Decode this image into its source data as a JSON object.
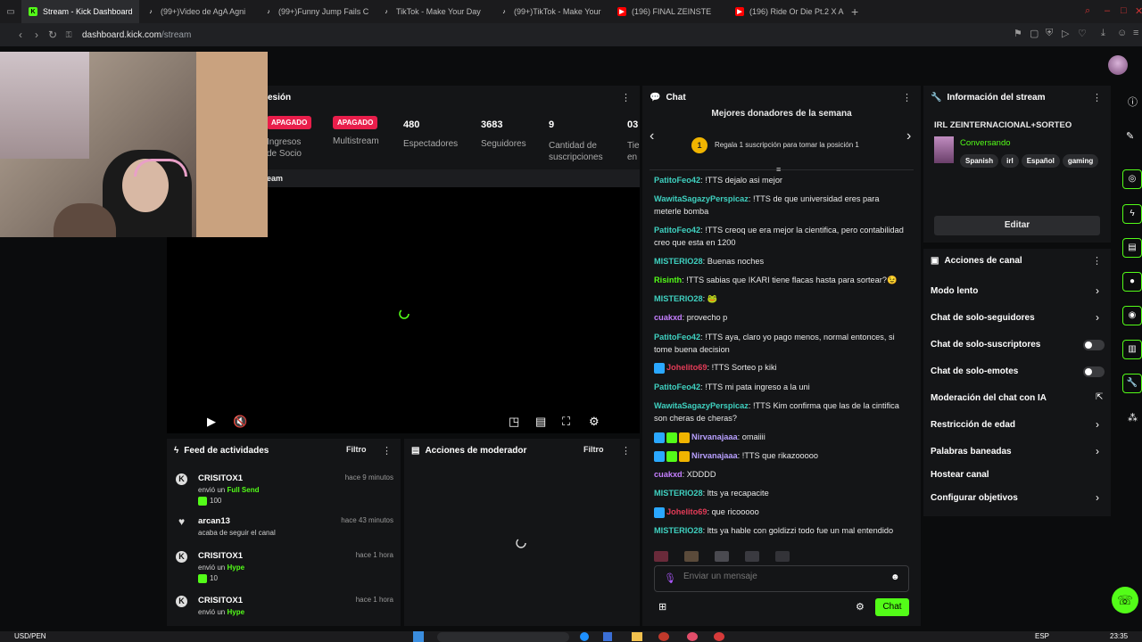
{
  "browser": {
    "tabs": [
      {
        "title": "Stream - Kick Dashboard",
        "active": true,
        "icon": "kick-icon"
      },
      {
        "title": "(99+)Video de AgA Agni",
        "active": false,
        "icon": "tiktok-icon"
      },
      {
        "title": "(99+)Funny Jump Fails C",
        "active": false,
        "icon": "tiktok-icon"
      },
      {
        "title": "TikTok - Make Your Day",
        "active": false,
        "icon": "tiktok-icon"
      },
      {
        "title": "(99+)TikTok - Make Your",
        "active": false,
        "icon": "tiktok-icon"
      },
      {
        "title": "(196) FINAL ZEINSTE",
        "active": false,
        "icon": "youtube-icon"
      },
      {
        "title": "(196) Ride Or Die Pt.2 X A",
        "active": false,
        "icon": "youtube-icon"
      }
    ],
    "url_host": "dashboard.kick.com",
    "url_path": "/stream"
  },
  "session": {
    "title": "esión",
    "stats": [
      {
        "badge": "APAGADO",
        "label": "Ingresos de Socio"
      },
      {
        "badge": "APAGADO",
        "label": "Multistream"
      },
      {
        "value": "480",
        "label": "Espectadores"
      },
      {
        "value": "3683",
        "label": "Seguidores"
      },
      {
        "value": "9",
        "label": "Cantidad de suscripciones"
      },
      {
        "value": "03",
        "label": "Tie en"
      }
    ],
    "stream_label": "eam"
  },
  "feed": {
    "title": "Feed de actividades",
    "filter": "Filtro",
    "items": [
      {
        "user": "CRISITOX1",
        "action": "envió un",
        "highlight": "Full Send",
        "amount": "100",
        "time": "hace 9 minutos",
        "icon": "kick-coin-icon"
      },
      {
        "user": "arcan13",
        "action": "acaba de seguir el canal",
        "highlight": "",
        "amount": "",
        "time": "hace 43 minutos",
        "icon": "heart-icon"
      },
      {
        "user": "CRISITOX1",
        "action": "envió un",
        "highlight": "Hype",
        "amount": "10",
        "time": "hace 1 hora",
        "icon": "kick-coin-icon"
      },
      {
        "user": "CRISITOX1",
        "action": "envió un",
        "highlight": "Hype",
        "amount": "",
        "time": "hace 1 hora",
        "icon": "kick-coin-icon"
      }
    ]
  },
  "moderator": {
    "title": "Acciones de moderador",
    "filter": "Filtro"
  },
  "chat": {
    "title": "Chat",
    "donors_title": "Mejores donadores de la semana",
    "donors_rank": "1",
    "donors_text": "Regala 1 suscripción para tomar la posición 1",
    "messages": [
      {
        "user": "PatitoFeo42",
        "cls": "u-g",
        "text": "!TTS dejalo asi mejor"
      },
      {
        "user": "WawitaSagazyPerspicaz",
        "cls": "u-g",
        "text": "!TTS de que universidad eres para meterle bomba"
      },
      {
        "user": "PatitoFeo42",
        "cls": "u-g",
        "text": "!TTS creoq ue era mejor la cientifica, pero contabilidad creo que esta en 1200"
      },
      {
        "user": "MISTERIO28",
        "cls": "u-g",
        "text": "Buenas noches"
      },
      {
        "user": "Risinth",
        "cls": "u-g",
        "text": "!TTS sabias que IKARI tiene flacas hasta para sortear?😉"
      },
      {
        "user": "MISTERIO28",
        "cls": "u-g",
        "text": "🐸"
      },
      {
        "user": "cuakxd",
        "cls": "u-p",
        "text": "provecho p"
      },
      {
        "user": "PatitoFeo42",
        "cls": "u-g",
        "text": "!TTS aya, claro yo pago menos, normal entonces, si tome buena decision"
      },
      {
        "user": "Johelito69",
        "cls": "u-r",
        "text": "!TTS Sorteo p kiki"
      },
      {
        "user": "PatitoFeo42",
        "cls": "u-g",
        "text": "!TTS mi pata ingreso a la uni"
      },
      {
        "user": "WawitaSagazyPerspicaz",
        "cls": "u-g",
        "text": "!TTS Kim confirma que las de la cintifica son cheras de cheras?"
      },
      {
        "user": "Nirvanajaaa",
        "cls": "u-v",
        "text": "omaiiii"
      },
      {
        "user": "Nirvanajaaa",
        "cls": "u-v",
        "text": "!TTS que rikazooooo"
      },
      {
        "user": "cuakxd",
        "cls": "u-p",
        "text": "XDDDD"
      },
      {
        "user": "MISTERIO28",
        "cls": "u-g",
        "text": "ltts ya recapacite"
      },
      {
        "user": "Johelito69",
        "cls": "u-r",
        "text": "que ricooooo"
      },
      {
        "user": "MISTERIO28",
        "cls": "u-g",
        "text": "ltts ya hable con goldizzi todo fue un mal entendido"
      }
    ],
    "input_placeholder": "Enviar un mensaje",
    "send_label": "Chat"
  },
  "stream_info": {
    "title": "Información del stream",
    "stream_title": "IRL ZEINTERNACIONAL+SORTEO",
    "category": "Conversando",
    "tags": [
      "Spanish",
      "irl",
      "Español",
      "gaming"
    ],
    "edit_label": "Editar"
  },
  "channel_actions": {
    "title": "Acciones de canal",
    "items": [
      {
        "label": "Modo lento",
        "control": "chevron"
      },
      {
        "label": "Chat de solo-seguidores",
        "control": "chevron"
      },
      {
        "label": "Chat de solo-suscriptores",
        "control": "toggle"
      },
      {
        "label": "Chat de solo-emotes",
        "control": "toggle"
      },
      {
        "label": "Moderación del chat con IA",
        "control": "external"
      },
      {
        "label": "Restricción de edad",
        "control": "chevron"
      },
      {
        "label": "Palabras baneadas",
        "control": "chevron"
      },
      {
        "label": "Hostear canal",
        "control": "none"
      },
      {
        "label": "Configurar objetivos",
        "control": "chevron"
      }
    ]
  },
  "taskbar": {
    "currency": "USD/PEN",
    "lang": "ESP",
    "time": "23:35"
  },
  "colors": {
    "accent": "#53fc18",
    "badge": "#e91e4b",
    "bg": "#0b0c0d",
    "panel": "#141517"
  }
}
